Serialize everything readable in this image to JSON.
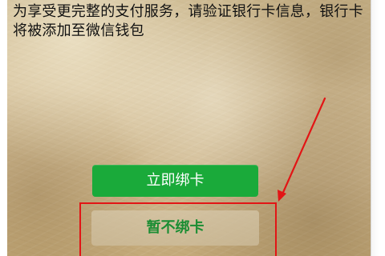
{
  "page": {
    "message": "为享受更完整的支付服务，请验证银行卡信息，银行卡将被添加至微信钱包"
  },
  "actions": {
    "bind_card_label": "立即绑卡",
    "not_now_label": "暂不绑卡"
  },
  "colors": {
    "primary_green": "#1aaa3a",
    "secondary_text_green": "#1b8d33",
    "annotation_red": "#e21515",
    "parchment_base": "#d7c39d"
  },
  "annotation": {
    "target": "暂不绑卡",
    "icon": "arrow-icon"
  }
}
